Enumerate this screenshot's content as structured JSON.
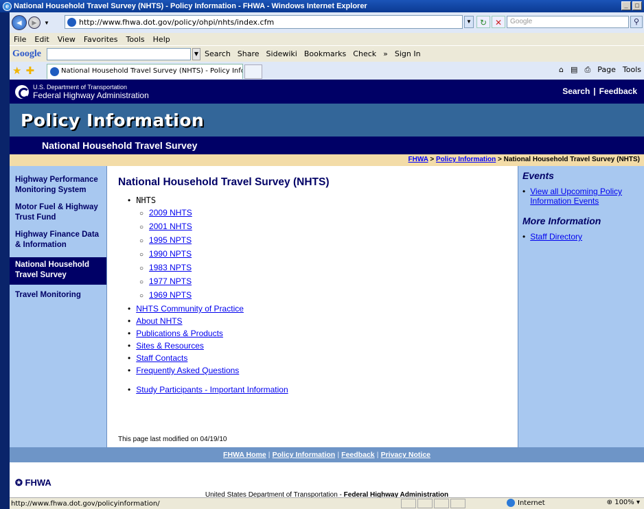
{
  "window": {
    "title": "National Household Travel Survey (NHTS) - Policy Information - FHWA - Windows Internet Explorer",
    "controls": [
      "_",
      "□"
    ]
  },
  "address": {
    "url": "http://www.fhwa.dot.gov/policy/ohpi/nhts/index.cfm",
    "search_placeholder": "Google"
  },
  "menu": [
    "File",
    "Edit",
    "View",
    "Favorites",
    "Tools",
    "Help"
  ],
  "google_toolbar": {
    "logo": "Google",
    "items": [
      "Search",
      "Share",
      "Sidewiki",
      "Bookmarks",
      "Check",
      "»",
      "Sign In"
    ]
  },
  "tab": {
    "label": "National Household Travel Survey (NHTS) - Policy Info..."
  },
  "command_bar": [
    "Page",
    "Tools"
  ],
  "site": {
    "dot_line1": "U.S. Department of Transportation",
    "dot_line2": "Federal Highway Administration",
    "header_links": [
      "Search",
      "Feedback"
    ],
    "title": "Policy Information",
    "subtitle": "National Household Travel Survey",
    "breadcrumb": {
      "fhwa": "FHWA",
      "policy": "Policy Information",
      "current": "National Household Travel Survey (NHTS)",
      "sep": ">"
    }
  },
  "left_nav": [
    "Highway Performance Monitoring System",
    "Motor Fuel & Highway Trust Fund",
    "Highway Finance Data & Information",
    "National Household Travel Survey",
    "Travel Monitoring"
  ],
  "main": {
    "heading": "National Household Travel Survey (NHTS)",
    "nhts_label": "NHTS",
    "surveys": [
      "2009 NHTS",
      "2001 NHTS",
      "1995 NPTS",
      "1990 NPTS",
      "1983 NPTS",
      "1977 NPTS",
      "1969 NPTS"
    ],
    "links": [
      "NHTS Community of Practice",
      "About NHTS",
      "Publications & Products",
      "Sites & Resources",
      "Staff Contacts",
      "Frequently Asked Questions"
    ],
    "study_link": "Study Participants - Important Information",
    "modified": "This page last modified on 04/19/10"
  },
  "right_nav": {
    "events_heading": "Events",
    "events_link": "View all Upcoming Policy Information Events",
    "more_heading": "More Information",
    "more_link": "Staff Directory"
  },
  "footer": {
    "links": [
      "FHWA Home",
      "Policy Information",
      "Feedback",
      "Privacy Notice"
    ],
    "logo": "FHWA",
    "note_prefix": "United States Department of Transportation - ",
    "note_bold": "Federal Highway Administration"
  },
  "status": {
    "url": "http://www.fhwa.dot.gov/policyinformation/",
    "zone": "Internet",
    "zoom": "100%"
  }
}
